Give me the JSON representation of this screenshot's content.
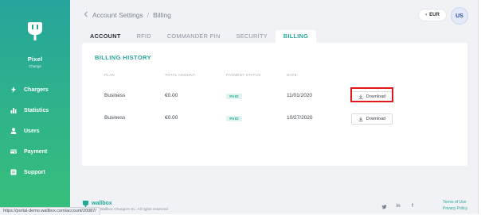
{
  "sidebar": {
    "user_name": "Pixel",
    "change_label": "Change",
    "items": [
      {
        "label": "Chargers",
        "icon": "bolt-icon"
      },
      {
        "label": "Statistics",
        "icon": "bar-chart-icon"
      },
      {
        "label": "Users",
        "icon": "user-icon"
      },
      {
        "label": "Payment",
        "icon": "payment-icon"
      },
      {
        "label": "Support",
        "icon": "support-icon"
      }
    ]
  },
  "header": {
    "breadcrumb": [
      "Account Settings",
      "Billing"
    ],
    "currency": "EUR",
    "avatar_initials": "US"
  },
  "tabs": [
    {
      "label": "ACCOUNT",
      "state": "default-bold"
    },
    {
      "label": "RFID",
      "state": "default"
    },
    {
      "label": "COMMANDER PIN",
      "state": "default"
    },
    {
      "label": "SECURITY",
      "state": "default"
    },
    {
      "label": "BILLING",
      "state": "active"
    }
  ],
  "billing": {
    "title": "BILLING HISTORY",
    "columns": [
      "PLAN",
      "TOTAL AMOUNT",
      "PAYMENT STATUS",
      "DATE"
    ],
    "rows": [
      {
        "plan": "Business",
        "amount": "€0.00",
        "status": "PAID",
        "date": "11/01/2020",
        "action": "Download",
        "highlighted": true
      },
      {
        "plan": "Business",
        "amount": "€0.00",
        "status": "PAID",
        "date": "10/27/2020",
        "action": "Download",
        "highlighted": false
      }
    ]
  },
  "footer": {
    "brand": "wallbox",
    "copyright": "Wallbox Chargers SL. All rights reserved",
    "links": [
      "Terms of Use",
      "Privacy Policy"
    ],
    "social_icons": [
      "twitter-icon",
      "linkedin-icon",
      "facebook-icon"
    ]
  },
  "status_url": "https://portal-demo.wallbox.com/account/20087/",
  "colors": {
    "accent": "#26a69a",
    "sidebar_top": "#25a59b",
    "sidebar_bottom": "#37bf7b",
    "highlight": "#e0161b"
  }
}
